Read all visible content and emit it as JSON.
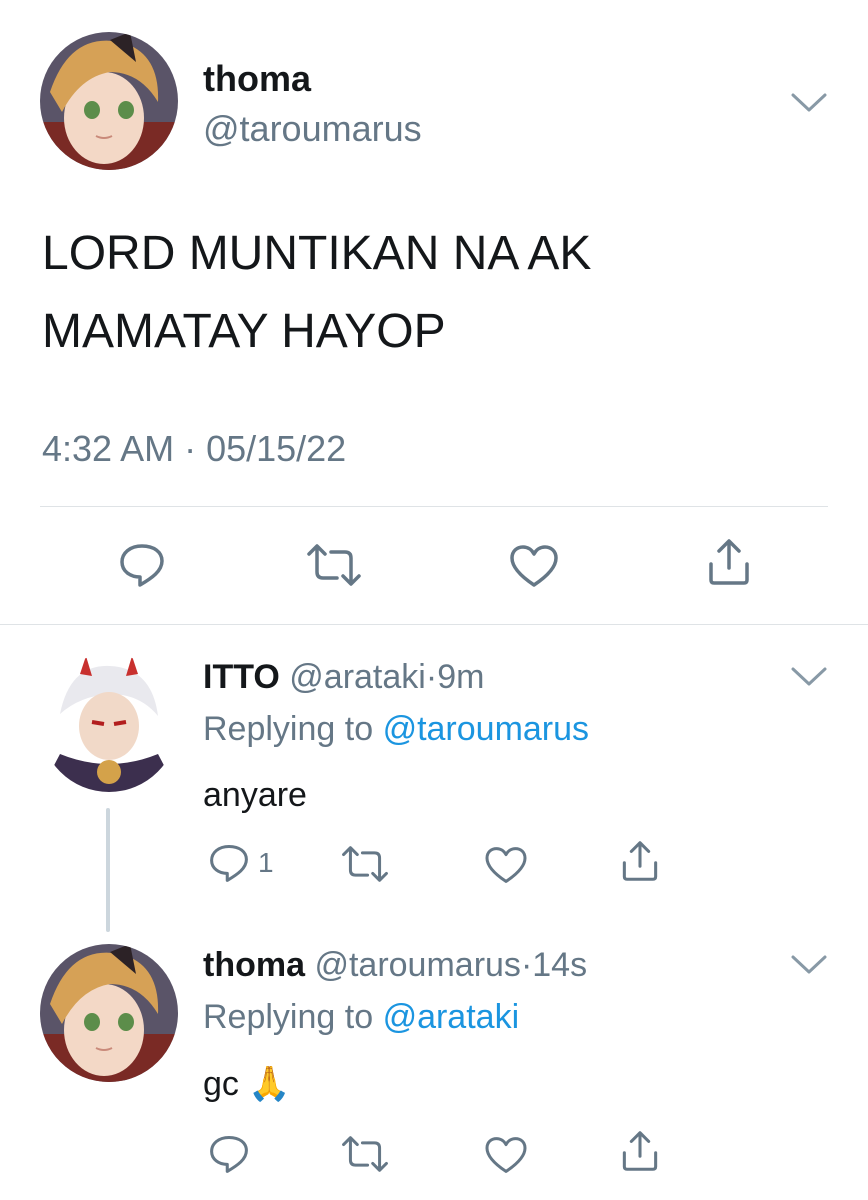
{
  "main_tweet": {
    "display_name": "thoma",
    "handle": "@taroumarus",
    "text_line1": "LORD MUNTIKAN NA AK",
    "text_line2": "MAMATAY HAYOP",
    "timestamp": "4:32 AM · 05/15/22",
    "avatar_desc": "avatar-thoma"
  },
  "replies": [
    {
      "display_name": "ITTO",
      "handle": "@arataki",
      "separator": "·",
      "time": "9m",
      "replying_prefix": "Replying to",
      "replying_to": "@taroumarus",
      "text": "anyare",
      "reply_count": "1"
    },
    {
      "display_name": "thoma",
      "handle": "@taroumarus",
      "separator": "·",
      "time": "14s",
      "replying_prefix": "Replying to",
      "replying_to": "@arataki",
      "text": "gc",
      "emoji": "🙏",
      "reply_count": ""
    }
  ],
  "icons": [
    "chevron-down-icon",
    "reply-icon",
    "retweet-icon",
    "like-icon",
    "share-icon"
  ],
  "colors": {
    "text": "#14171a",
    "secondary": "#657786",
    "link": "#1b95e0",
    "divider": "#dfe3e6"
  }
}
